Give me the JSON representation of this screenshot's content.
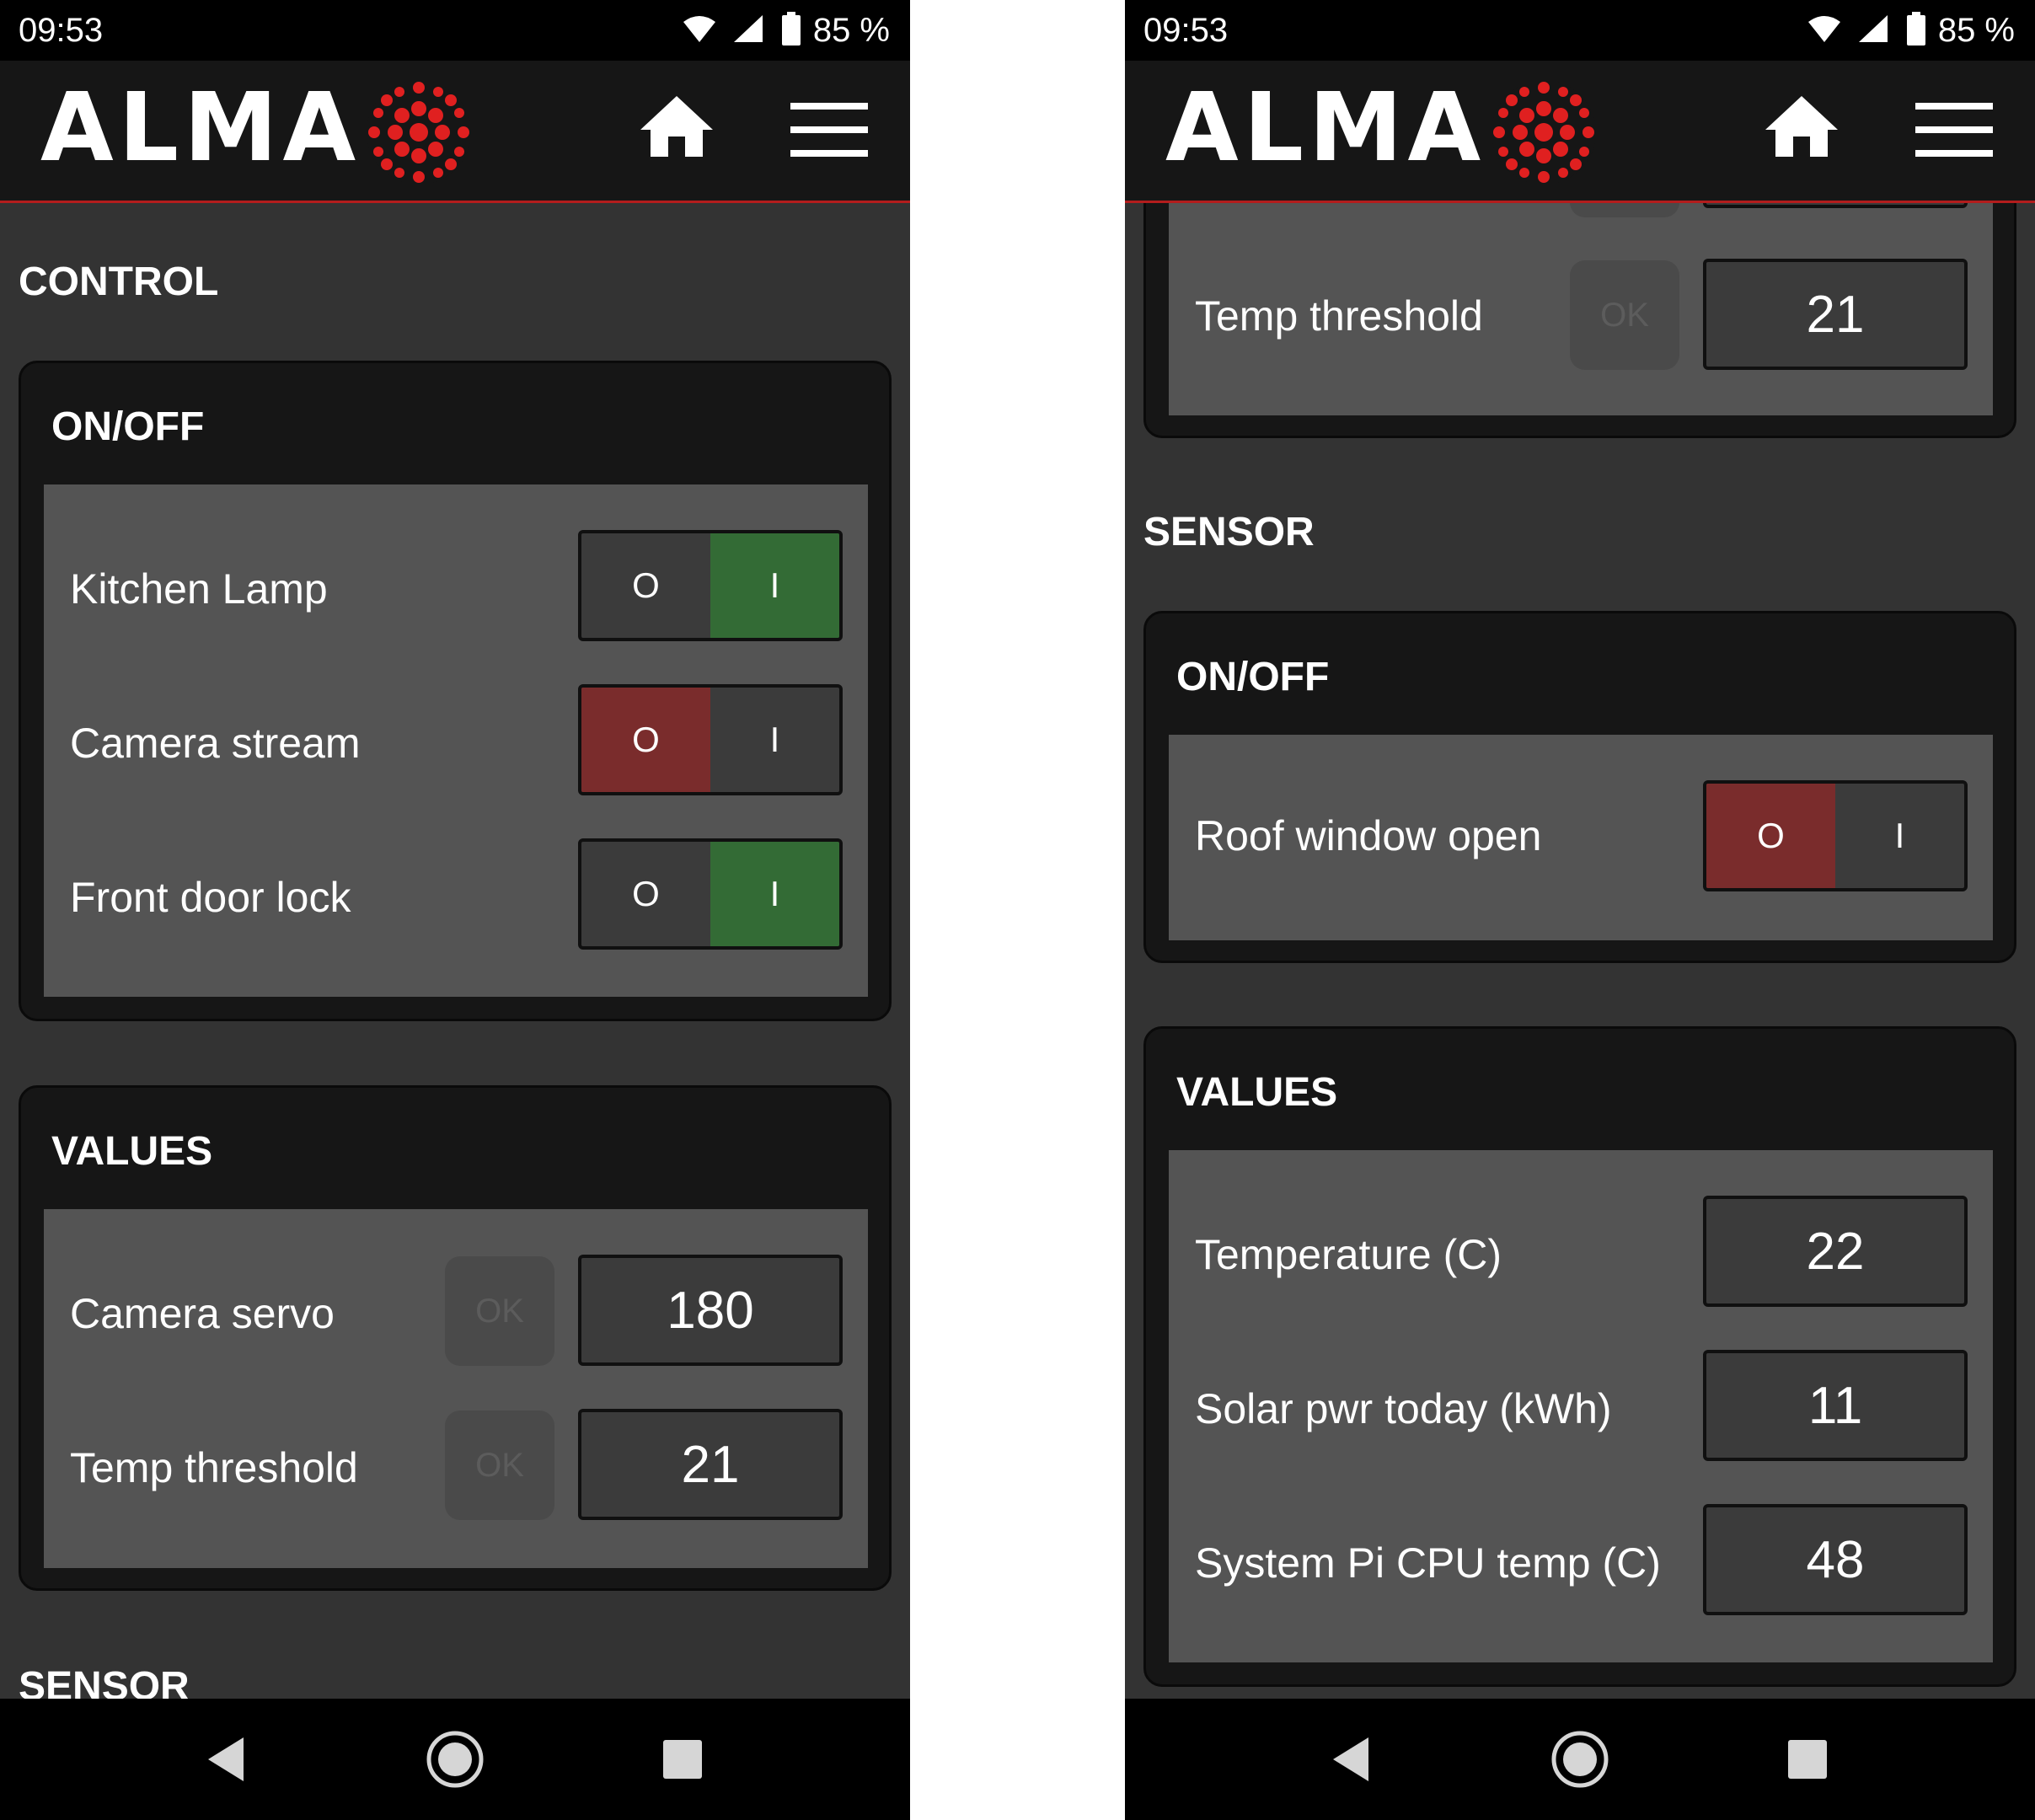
{
  "status_bar": {
    "time": "09:53",
    "battery": "85 %"
  },
  "header": {
    "logo_text": "ALMA",
    "brand_color": "#e02020",
    "accent_line": "#b31d1d"
  },
  "icons": {
    "home": "home-icon",
    "menu": "hamburger-menu-icon",
    "back": "back-triangle-icon",
    "home_nav": "home-circle-icon",
    "recents": "recents-square-icon"
  },
  "left": {
    "control_title": "CONTROL",
    "onoff": {
      "title": "ON/OFF",
      "rows": [
        {
          "label": "Kitchen Lamp",
          "off": "O",
          "on": "I",
          "state": "on"
        },
        {
          "label": "Camera stream",
          "off": "O",
          "on": "I",
          "state": "off"
        },
        {
          "label": "Front door lock",
          "off": "O",
          "on": "I",
          "state": "on"
        }
      ]
    },
    "values": {
      "title": "VALUES",
      "rows": [
        {
          "label": "Camera servo",
          "ok": "OK",
          "value": "180"
        },
        {
          "label": "Temp threshold",
          "ok": "OK",
          "value": "21"
        }
      ]
    },
    "sensor_title": "SENSOR"
  },
  "right": {
    "values_partial": {
      "rows": [
        {
          "label": "Temp threshold",
          "ok": "OK",
          "value": "21"
        }
      ]
    },
    "sensor_title": "SENSOR",
    "onoff": {
      "title": "ON/OFF",
      "rows": [
        {
          "label": "Roof window open",
          "off": "O",
          "on": "I",
          "state": "off"
        }
      ]
    },
    "values": {
      "title": "VALUES",
      "rows": [
        {
          "label": "Temperature (C)",
          "value": "22"
        },
        {
          "label": "Solar pwr today (kWh)",
          "value": "11"
        },
        {
          "label": "System Pi CPU temp (C)",
          "value": "48"
        }
      ]
    }
  }
}
